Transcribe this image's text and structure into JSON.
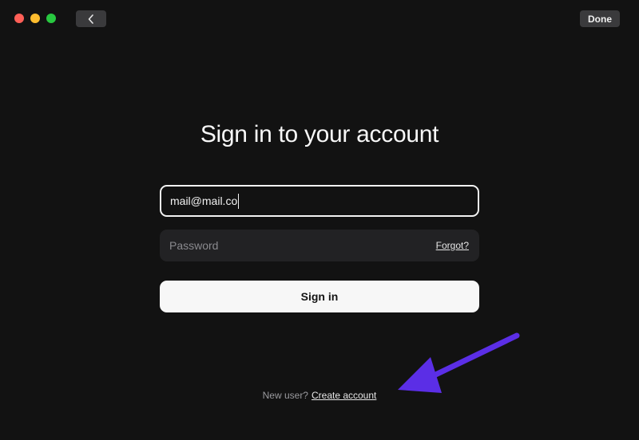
{
  "window": {
    "traffic_lights": {
      "close_color": "#ff5f57",
      "minimize_color": "#febc2e",
      "zoom_color": "#28c840"
    },
    "back_icon": "chevron-left-icon",
    "done_label": "Done"
  },
  "signin": {
    "title": "Sign in to your account",
    "email_value": "mail@mail.co",
    "password_placeholder": "Password",
    "forgot_label": "Forgot?",
    "submit_label": "Sign in"
  },
  "footer": {
    "prompt": "New user?",
    "create_label": "Create account"
  },
  "annotation": {
    "arrow_color": "#5b2ee6",
    "arrow_icon": "arrow-pointer-icon"
  }
}
